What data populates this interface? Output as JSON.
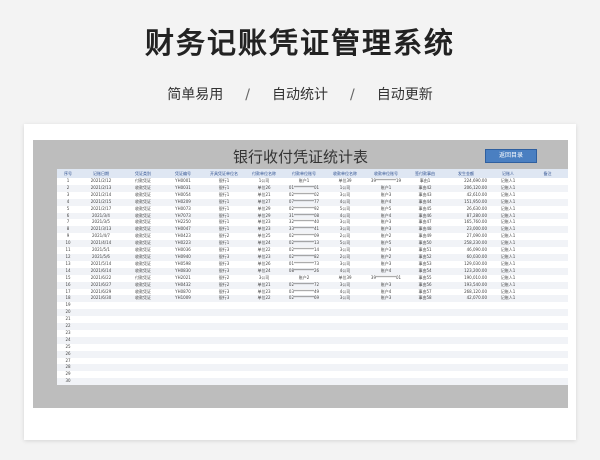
{
  "banner": {
    "title": "财务记账凭证管理系统"
  },
  "subtitle": {
    "items": [
      "简单易用",
      "自动统计",
      "自动更新"
    ],
    "separator": "/"
  },
  "sheet": {
    "title": "银行收付凭证统计表",
    "button_label": "返回目录",
    "columns": [
      "序号",
      "记账日期",
      "凭证类别",
      "凭证编号",
      "开具凭证单位名",
      "付款单位名称",
      "付款单位账号",
      "收款单位名称",
      "收款单位账号",
      "签付款事由",
      "发生金额",
      "记账人",
      "备注"
    ],
    "rows": [
      [
        "1",
        "2021/2/12",
        "付款凭证",
        "YH0001",
        "银行1",
        "1公司",
        "账户1",
        "单位39",
        "39**********19",
        "事由1",
        "224,690.00",
        "记账人1",
        ""
      ],
      [
        "2",
        "2021/2/13",
        "收款凭证",
        "YH0031",
        "银行1",
        "单位26",
        "01**********01",
        "1公司",
        "账户1",
        "事由42",
        "206,120.00",
        "记账人1",
        ""
      ],
      [
        "3",
        "2021/2/14",
        "收款凭证",
        "YH0054",
        "银行1",
        "单位21",
        "02**********02",
        "3公司",
        "账户3",
        "事由43",
        "42,610.00",
        "记账人1",
        ""
      ],
      [
        "4",
        "2021/2/15",
        "收款凭证",
        "YH0209",
        "银行1",
        "单位27",
        "07**********77",
        "4公司",
        "账户4",
        "事由44",
        "151,950.00",
        "记账人1",
        ""
      ],
      [
        "5",
        "2021/2/17",
        "收款凭证",
        "YH0073",
        "银行1",
        "单位29",
        "02**********92",
        "5公司",
        "账户5",
        "事由45",
        "26,630.00",
        "记账人1",
        ""
      ],
      [
        "6",
        "2021/3/4",
        "收款凭证",
        "YH7073",
        "银行1",
        "单位29",
        "31**********08",
        "4公司",
        "账户4",
        "事由46",
        "87,280.00",
        "记账人1",
        ""
      ],
      [
        "7",
        "2021/3/5",
        "收款凭证",
        "YH2250",
        "银行1",
        "单位23",
        "32**********40",
        "3公司",
        "账户3",
        "事由47",
        "165,760.00",
        "记账人1",
        ""
      ],
      [
        "8",
        "2021/3/13",
        "收款凭证",
        "YH0047",
        "银行1",
        "单位23",
        "33**********41",
        "3公司",
        "账户3",
        "事由48",
        "23,000.00",
        "记账人1",
        ""
      ],
      [
        "9",
        "2021/4/7",
        "收款凭证",
        "YH0423",
        "银行2",
        "单位25",
        "02**********09",
        "2公司",
        "账户2",
        "事由49",
        "27,090.00",
        "记账人1",
        ""
      ],
      [
        "10",
        "2021/4/14",
        "收款凭证",
        "YH0223",
        "银行1",
        "单位24",
        "02**********13",
        "5公司",
        "账户5",
        "事由50",
        "258,230.00",
        "记账人1",
        ""
      ],
      [
        "11",
        "2021/5/1",
        "收款凭证",
        "YH0036",
        "银行3",
        "单位22",
        "02**********14",
        "3公司",
        "账户3",
        "事由51",
        "46,090.00",
        "记账人1",
        ""
      ],
      [
        "12",
        "2021/5/6",
        "收款凭证",
        "YH0940",
        "银行3",
        "单位23",
        "02**********82",
        "2公司",
        "账户2",
        "事由52",
        "60,030.00",
        "记账人1",
        ""
      ],
      [
        "13",
        "2021/5/14",
        "收款凭证",
        "YH0598",
        "银行3",
        "单位26",
        "01**********73",
        "3公司",
        "账户3",
        "事由53",
        "129,030.00",
        "记账人1",
        ""
      ],
      [
        "14",
        "2021/6/14",
        "收款凭证",
        "YH0830",
        "银行3",
        "单位24",
        "08**********26",
        "4公司",
        "账户4",
        "事由54",
        "123,200.00",
        "记账人1",
        ""
      ],
      [
        "15",
        "2021/6/22",
        "付款凭证",
        "YH2021",
        "银行2",
        "3公司",
        "账户2",
        "单位39",
        "39**********01",
        "事由55",
        "190,010.00",
        "记账人1",
        ""
      ],
      [
        "16",
        "2021/6/27",
        "收款凭证",
        "YH0432",
        "银行2",
        "单位21",
        "02**********72",
        "3公司",
        "账户3",
        "事由56",
        "193,540.00",
        "记账人1",
        ""
      ],
      [
        "17",
        "2021/6/29",
        "收款凭证",
        "YH0870",
        "银行3",
        "单位23",
        "03**********49",
        "4公司",
        "账户4",
        "事由57",
        "268,120.00",
        "记账人1",
        ""
      ],
      [
        "18",
        "2021/6/30",
        "收款凭证",
        "YH1009",
        "银行3",
        "单位22",
        "02**********69",
        "3公司",
        "账户3",
        "事由58",
        "42,070.00",
        "记账人1",
        ""
      ],
      [
        "19",
        "",
        "",
        "",
        "",
        "",
        "",
        "",
        "",
        "",
        "",
        "",
        ""
      ],
      [
        "20",
        "",
        "",
        "",
        "",
        "",
        "",
        "",
        "",
        "",
        "",
        "",
        ""
      ],
      [
        "21",
        "",
        "",
        "",
        "",
        "",
        "",
        "",
        "",
        "",
        "",
        "",
        ""
      ],
      [
        "22",
        "",
        "",
        "",
        "",
        "",
        "",
        "",
        "",
        "",
        "",
        "",
        ""
      ],
      [
        "23",
        "",
        "",
        "",
        "",
        "",
        "",
        "",
        "",
        "",
        "",
        "",
        ""
      ],
      [
        "24",
        "",
        "",
        "",
        "",
        "",
        "",
        "",
        "",
        "",
        "",
        "",
        ""
      ],
      [
        "25",
        "",
        "",
        "",
        "",
        "",
        "",
        "",
        "",
        "",
        "",
        "",
        ""
      ],
      [
        "26",
        "",
        "",
        "",
        "",
        "",
        "",
        "",
        "",
        "",
        "",
        "",
        ""
      ],
      [
        "27",
        "",
        "",
        "",
        "",
        "",
        "",
        "",
        "",
        "",
        "",
        "",
        ""
      ],
      [
        "28",
        "",
        "",
        "",
        "",
        "",
        "",
        "",
        "",
        "",
        "",
        "",
        ""
      ],
      [
        "29",
        "",
        "",
        "",
        "",
        "",
        "",
        "",
        "",
        "",
        "",
        "",
        ""
      ],
      [
        "30",
        "",
        "",
        "",
        "",
        "",
        "",
        "",
        "",
        "",
        "",
        "",
        ""
      ]
    ]
  }
}
